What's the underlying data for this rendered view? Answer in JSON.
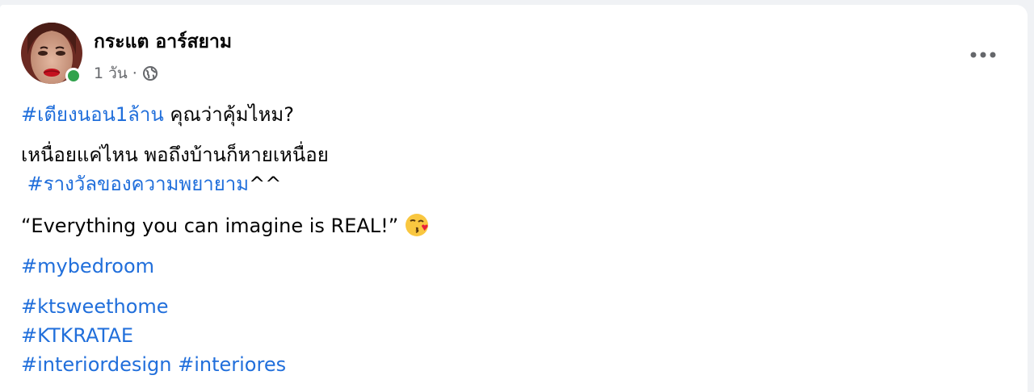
{
  "post": {
    "author": "กระแต อาร์สยาม",
    "time": "1 วัน",
    "separator": "·",
    "privacy_icon": "globe-icon",
    "more_icon": "more-dots-icon",
    "online": true
  },
  "content": {
    "line1": {
      "hashtag": "#เตียงนอน1ล้าน",
      "text": " คุณว่าคุ้มไหม?"
    },
    "line2": {
      "text": "เหนื่อยแค่ไหน พอถึงบ้านก็หายเหนื่อย"
    },
    "line3": {
      "prefix": " ",
      "hashtag": "#รางวัลของความพยายาม",
      "suffix": "^^"
    },
    "line4": {
      "text": "“Everything you can imagine is REAL!”",
      "emoji": "kiss-emoji"
    },
    "line5": {
      "hashtag": "#mybedroom"
    },
    "line6": {
      "hashtag": "#ktsweethome"
    },
    "line7": {
      "hashtag": "#KTKRATAE"
    },
    "line8": {
      "hashtag1": "#interiordesign",
      "space": " ",
      "hashtag2": "#interiores"
    }
  },
  "colors": {
    "link": "#216fdb",
    "text": "#050505",
    "muted": "#65676b",
    "online": "#31a24c",
    "background": "#f0f2f5"
  }
}
